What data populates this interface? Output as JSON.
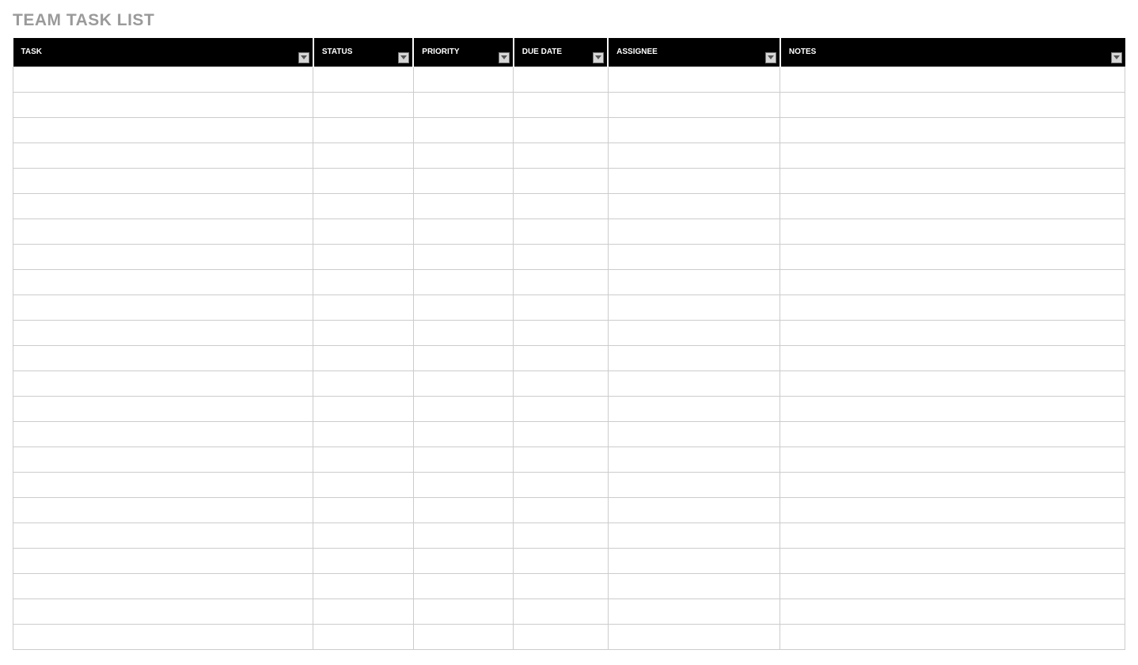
{
  "title": "TEAM TASK LIST",
  "columns": [
    {
      "label": "TASK",
      "key": "task"
    },
    {
      "label": "STATUS",
      "key": "status"
    },
    {
      "label": "PRIORITY",
      "key": "priority"
    },
    {
      "label": "DUE DATE",
      "key": "duedate"
    },
    {
      "label": "ASSIGNEE",
      "key": "assignee"
    },
    {
      "label": "NOTES",
      "key": "notes"
    }
  ],
  "rows": [
    {
      "task": "",
      "status": "",
      "priority": "",
      "duedate": "",
      "assignee": "",
      "notes": ""
    },
    {
      "task": "",
      "status": "",
      "priority": "",
      "duedate": "",
      "assignee": "",
      "notes": ""
    },
    {
      "task": "",
      "status": "",
      "priority": "",
      "duedate": "",
      "assignee": "",
      "notes": ""
    },
    {
      "task": "",
      "status": "",
      "priority": "",
      "duedate": "",
      "assignee": "",
      "notes": ""
    },
    {
      "task": "",
      "status": "",
      "priority": "",
      "duedate": "",
      "assignee": "",
      "notes": ""
    },
    {
      "task": "",
      "status": "",
      "priority": "",
      "duedate": "",
      "assignee": "",
      "notes": ""
    },
    {
      "task": "",
      "status": "",
      "priority": "",
      "duedate": "",
      "assignee": "",
      "notes": ""
    },
    {
      "task": "",
      "status": "",
      "priority": "",
      "duedate": "",
      "assignee": "",
      "notes": ""
    },
    {
      "task": "",
      "status": "",
      "priority": "",
      "duedate": "",
      "assignee": "",
      "notes": ""
    },
    {
      "task": "",
      "status": "",
      "priority": "",
      "duedate": "",
      "assignee": "",
      "notes": ""
    },
    {
      "task": "",
      "status": "",
      "priority": "",
      "duedate": "",
      "assignee": "",
      "notes": ""
    },
    {
      "task": "",
      "status": "",
      "priority": "",
      "duedate": "",
      "assignee": "",
      "notes": ""
    },
    {
      "task": "",
      "status": "",
      "priority": "",
      "duedate": "",
      "assignee": "",
      "notes": ""
    },
    {
      "task": "",
      "status": "",
      "priority": "",
      "duedate": "",
      "assignee": "",
      "notes": ""
    },
    {
      "task": "",
      "status": "",
      "priority": "",
      "duedate": "",
      "assignee": "",
      "notes": ""
    },
    {
      "task": "",
      "status": "",
      "priority": "",
      "duedate": "",
      "assignee": "",
      "notes": ""
    },
    {
      "task": "",
      "status": "",
      "priority": "",
      "duedate": "",
      "assignee": "",
      "notes": ""
    },
    {
      "task": "",
      "status": "",
      "priority": "",
      "duedate": "",
      "assignee": "",
      "notes": ""
    },
    {
      "task": "",
      "status": "",
      "priority": "",
      "duedate": "",
      "assignee": "",
      "notes": ""
    },
    {
      "task": "",
      "status": "",
      "priority": "",
      "duedate": "",
      "assignee": "",
      "notes": ""
    },
    {
      "task": "",
      "status": "",
      "priority": "",
      "duedate": "",
      "assignee": "",
      "notes": ""
    },
    {
      "task": "",
      "status": "",
      "priority": "",
      "duedate": "",
      "assignee": "",
      "notes": ""
    },
    {
      "task": "",
      "status": "",
      "priority": "",
      "duedate": "",
      "assignee": "",
      "notes": ""
    }
  ]
}
